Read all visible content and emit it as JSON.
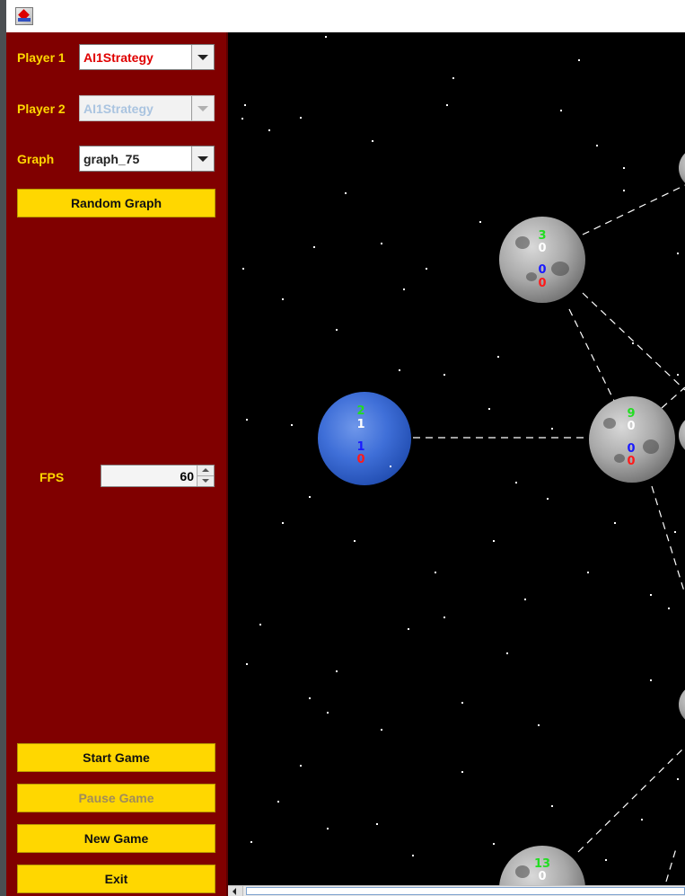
{
  "sidebar": {
    "player1_label": "Player 1",
    "player1_value": "AI1Strategy",
    "player2_label": "Player 2",
    "player2_value": "AI1Strategy",
    "graph_label": "Graph",
    "graph_value": "graph_75",
    "random_graph_button": "Random Graph",
    "fps_label": "FPS",
    "fps_value": "60",
    "start_button": "Start Game",
    "pause_button": "Pause Game",
    "new_button": "New Game",
    "exit_button": "Exit"
  },
  "colors": {
    "sidebar_bg": "#800000",
    "label_yellow": "#ffd700",
    "button_yellow": "#ffd700",
    "player1_text": "#e00000",
    "player2_text_disabled": "#aac4e0",
    "stat_green": "#22dd22",
    "stat_blue": "#1a1aff",
    "stat_red": "#ff1a1a"
  },
  "planets": {
    "moon_top": {
      "green": "3",
      "white": "0",
      "blue": "0",
      "red": "0"
    },
    "neptune": {
      "green": "2",
      "white": "1",
      "blue": "1",
      "red": "0"
    },
    "moon_mid": {
      "green": "9",
      "white": "0",
      "blue": "0",
      "red": "0"
    },
    "moon_bottom": {
      "green": "13",
      "white": "0"
    }
  },
  "icons": {
    "app": "java-app-icon",
    "dropdown": "chevron-down-icon"
  }
}
